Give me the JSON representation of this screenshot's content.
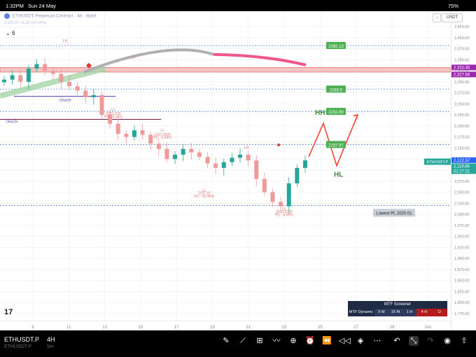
{
  "status_bar": {
    "time": "1:32PM",
    "date": "Sun 24 May",
    "battery": "75%"
  },
  "header": {
    "title": "ETHUSDT Perpetual Contract · 4h · Bybit",
    "ohlc_line": "2,122.57 +5.22 (+0.16%)",
    "indicator_count": "6"
  },
  "top_right": {
    "currency": "USDT"
  },
  "y_axis": {
    "ticks": [
      "2,425.00",
      "2,400.00",
      "2,375.00",
      "2,350.00",
      "2,325.00",
      "2,300.00",
      "2,275.00",
      "2,250.00",
      "2,225.00",
      "2,200.00",
      "2,175.00",
      "2,150.00",
      "2,125.00",
      "2,100.00",
      "2,075.00",
      "2,050.00",
      "2,025.00",
      "2,000.00",
      "1,975.00",
      "1,950.00",
      "1,925.00",
      "1,900.00",
      "1,875.00",
      "1,850.00",
      "1,825.00",
      "1,800.00",
      "1,775.00"
    ]
  },
  "x_axis": {
    "ticks": [
      "9",
      "11",
      "13",
      "15",
      "17",
      "19",
      "21",
      "23",
      "25",
      "27",
      "29",
      "Jun"
    ]
  },
  "price_badges": [
    {
      "label": "2,332.45",
      "color": "#9c27b0"
    },
    {
      "label": "2,327.66",
      "color": "#9c27b0"
    },
    {
      "label": "2,122.57",
      "color": "#2962ff"
    },
    {
      "label": "2,119.86",
      "color": "#26a69a"
    },
    {
      "label": "01:27:31",
      "color": "#26a69a"
    }
  ],
  "last_price_label": "ETHUSDT.P",
  "levels": [
    {
      "label": "2382.13",
      "price": 2382.13
    },
    {
      "label": "2283.5",
      "price": 2283.5
    },
    {
      "label": "2232.89",
      "price": 2232.89
    },
    {
      "label": "2157.97",
      "price": 2157.97
    }
  ],
  "lowest_pl": {
    "label": "Lowest PL 2020.01",
    "price": 2020.01
  },
  "projection": {
    "hh": "HH",
    "hl": "HL"
  },
  "annotations": [
    {
      "text": "LH",
      "type": "swing"
    },
    {
      "text": "LH",
      "type": "swing"
    },
    {
      "text": "LL",
      "type": "swing"
    },
    {
      "text": "2251.576",
      "type": "price"
    },
    {
      "text": "PC: -8.38%",
      "type": "pct"
    },
    {
      "text": "LL",
      "type": "swing"
    },
    {
      "text": "2167.0525",
      "type": "price"
    },
    {
      "text": "PC: -5.64%",
      "type": "pct"
    },
    {
      "text": "LL",
      "type": "swing"
    },
    {
      "text": "2111.15",
      "type": "price"
    },
    {
      "text": "PC: -10.46%",
      "type": "pct"
    },
    {
      "text": "LH",
      "type": "swing"
    },
    {
      "text": "LL",
      "type": "swing"
    },
    {
      "text": "2010.9726",
      "type": "price"
    },
    {
      "text": "PC: -6.89%",
      "type": "pct"
    },
    {
      "text": "CHoCH",
      "type": "structure"
    },
    {
      "text": "CHoCH",
      "type": "structure"
    }
  ],
  "mtf": {
    "title": "MTF Screener",
    "cells": [
      "MTF Dynamic",
      "5 M",
      "15 M",
      "1 H",
      "4 H",
      "D"
    ]
  },
  "bottom_bar": {
    "symbol": "ETHUSDT.P",
    "symbol_sub": "ETHUSDT.P",
    "timeframe": "4H",
    "timeframe_sub": "5m"
  },
  "colors": {
    "bull": "#26a69a",
    "bear": "#ef9a9a",
    "level": "#4caf50",
    "projection": "#f44336"
  },
  "chart_data": {
    "type": "candlestick",
    "x": [
      "9",
      "11",
      "13",
      "15",
      "17",
      "19",
      "21",
      "23",
      "25",
      "27",
      "29",
      "Jun"
    ],
    "ylim": [
      1775,
      2425
    ],
    "close_path": [
      2305,
      2315,
      2300,
      2330,
      2340,
      2325,
      2318,
      2300,
      2290,
      2280,
      2265,
      2270,
      2225,
      2205,
      2182,
      2175,
      2190,
      2180,
      2160,
      2148,
      2125,
      2135,
      2148,
      2140,
      2130,
      2115,
      2105,
      2118,
      2128,
      2135,
      2122,
      2080,
      2050,
      2028,
      2018,
      2070,
      2105,
      2122
    ],
    "projection_points": [
      2130,
      2206,
      2110,
      2225
    ]
  }
}
